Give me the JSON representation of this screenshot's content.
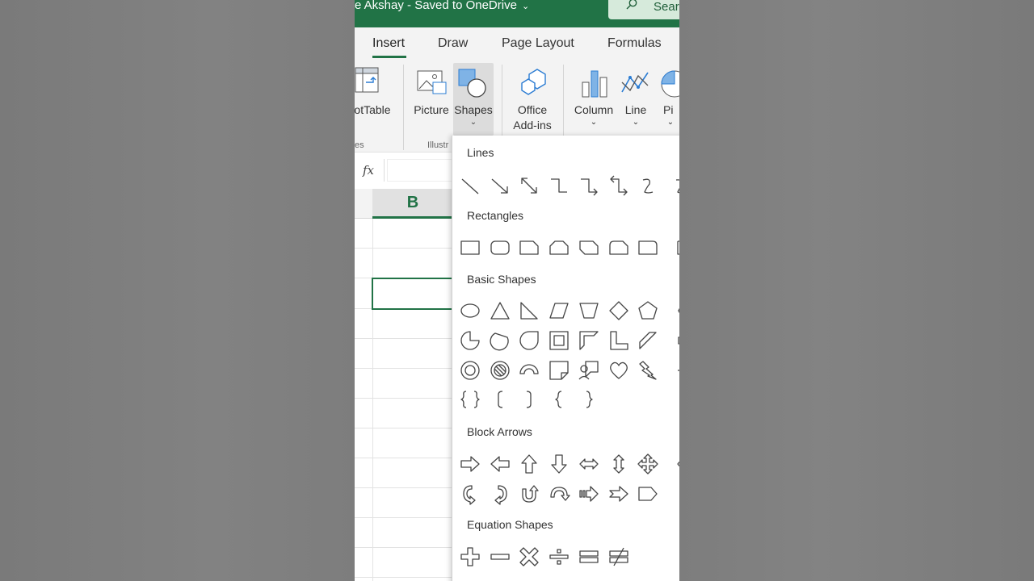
{
  "titlebar": {
    "document_title": "e Akshay  -  Saved to OneDrive",
    "search_label": "Sear"
  },
  "tabs": [
    {
      "label": "Insert",
      "active": true
    },
    {
      "label": "Draw"
    },
    {
      "label": "Page Layout"
    },
    {
      "label": "Formulas"
    }
  ],
  "ribbon": {
    "buttons": [
      {
        "label": "otTable"
      },
      {
        "label": "Picture"
      },
      {
        "label": "Shapes",
        "has_dropdown": true
      },
      {
        "label_line1": "Office",
        "label_line2": "Add-ins"
      },
      {
        "label": "Column",
        "has_dropdown": true
      },
      {
        "label": "Line",
        "has_dropdown": true
      },
      {
        "label": "Pi",
        "has_dropdown": true
      }
    ],
    "groups": [
      {
        "label": "es"
      },
      {
        "label": "Illustr"
      }
    ]
  },
  "formula_bar": {
    "fx_label": "fx"
  },
  "sheet": {
    "column_header": "B"
  },
  "shapes_panel": {
    "sections": [
      {
        "title": "Lines",
        "icons": [
          "line-icon",
          "line-arrow-icon",
          "line-double-arrow-icon",
          "elbow-connector-icon",
          "elbow-arrow-connector-icon",
          "elbow-double-arrow-connector-icon",
          "curved-connector-icon",
          "curved-connector-partial-icon"
        ]
      },
      {
        "title": "Rectangles",
        "icons": [
          "rectangle-icon",
          "rounded-rectangle-icon",
          "snip-single-corner-rectangle-icon",
          "snip-same-side-rectangle-icon",
          "snip-diagonal-rectangle-icon",
          "snip-round-rectangle-icon",
          "round-single-corner-rectangle-icon",
          "rectangle-partial-icon"
        ]
      },
      {
        "title": "Basic Shapes",
        "icons": [
          "oval-icon",
          "triangle-icon",
          "right-triangle-icon",
          "parallelogram-icon",
          "trapezoid-icon",
          "diamond-icon",
          "pentagon-icon",
          "hexagon-partial-icon",
          "pie-icon",
          "chord-icon",
          "teardrop-icon",
          "frame-icon",
          "half-frame-icon",
          "l-shape-icon",
          "diagonal-stripe-icon",
          "cross-partial-icon",
          "donut-icon",
          "no-symbol-icon",
          "block-arc-icon",
          "folded-corner-icon",
          "smiley-callout-icon",
          "heart-icon",
          "lightning-bolt-icon",
          "sun-partial-icon",
          "double-brace-icon",
          "left-bracket-icon",
          "right-bracket-icon",
          "left-brace-icon",
          "right-brace-icon"
        ]
      },
      {
        "title": "Block Arrows",
        "icons": [
          "right-arrow-icon",
          "left-arrow-icon",
          "up-arrow-icon",
          "down-arrow-icon",
          "left-right-arrow-icon",
          "up-down-arrow-icon",
          "quad-arrow-icon",
          "left-up-arrow-partial-icon",
          "curved-right-arrow-icon",
          "curved-left-arrow-icon",
          "u-turn-up-arrow-icon",
          "curved-down-arrow-icon",
          "striped-right-arrow-icon",
          "notched-right-arrow-icon",
          "pentagon-arrow-icon",
          "chevron-partial-icon"
        ]
      },
      {
        "title": "Equation Shapes",
        "icons": [
          "plus-sign-icon",
          "minus-sign-icon",
          "multiply-sign-icon",
          "division-sign-icon",
          "equal-sign-icon",
          "not-equal-sign-icon"
        ]
      }
    ]
  },
  "colors": {
    "excel_green": "#217346",
    "accent_blue": "#2b7cd3"
  }
}
